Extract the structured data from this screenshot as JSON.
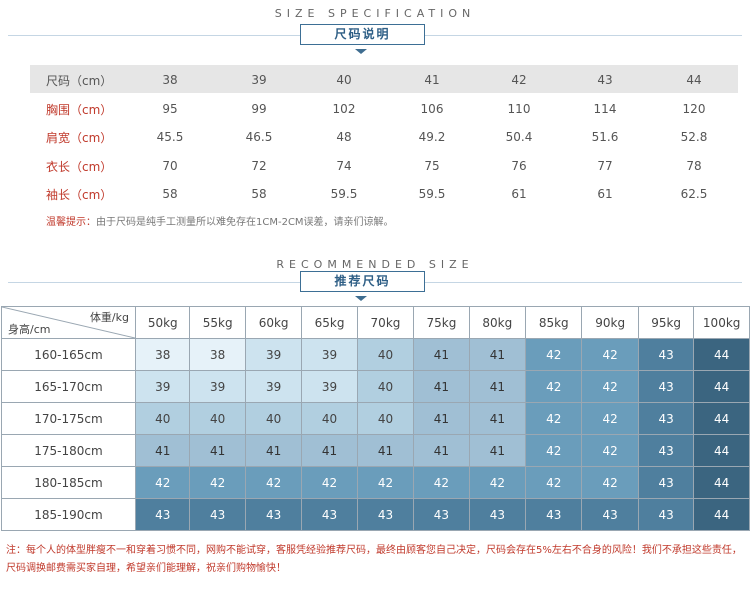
{
  "size_spec": {
    "eng_title": "SIZE SPECIFICATION",
    "cn_title": "尺码说明",
    "rows": [
      {
        "label": "尺码（cm）",
        "values": [
          "38",
          "39",
          "40",
          "41",
          "42",
          "43",
          "44"
        ]
      },
      {
        "label": "胸围（cm）",
        "values": [
          "95",
          "99",
          "102",
          "106",
          "110",
          "114",
          "120"
        ]
      },
      {
        "label": "肩宽（cm）",
        "values": [
          "45.5",
          "46.5",
          "48",
          "49.2",
          "50.4",
          "51.6",
          "52.8"
        ]
      },
      {
        "label": "衣长（cm）",
        "values": [
          "70",
          "72",
          "74",
          "75",
          "76",
          "77",
          "78"
        ]
      },
      {
        "label": "袖长（cm）",
        "values": [
          "58",
          "58",
          "59.5",
          "59.5",
          "61",
          "61",
          "62.5"
        ]
      }
    ],
    "tip_label": "温馨提示：",
    "tip_text": "由于尺码是纯手工测量所以难免存在1CM-2CM误差，请亲们谅解。"
  },
  "recommend": {
    "eng_title": "RECOMMENDED SIZE",
    "cn_title": "推荐尺码",
    "corner_weight": "体重/kg",
    "corner_height": "身高/cm",
    "weights": [
      "50kg",
      "55kg",
      "60kg",
      "65kg",
      "70kg",
      "75kg",
      "80kg",
      "85kg",
      "90kg",
      "95kg",
      "100kg"
    ],
    "rows": [
      {
        "height": "160-165cm",
        "sizes": [
          "38",
          "38",
          "39",
          "39",
          "40",
          "41",
          "41",
          "42",
          "42",
          "43",
          "44"
        ]
      },
      {
        "height": "165-170cm",
        "sizes": [
          "39",
          "39",
          "39",
          "39",
          "40",
          "41",
          "41",
          "42",
          "42",
          "43",
          "44"
        ]
      },
      {
        "height": "170-175cm",
        "sizes": [
          "40",
          "40",
          "40",
          "40",
          "40",
          "41",
          "41",
          "42",
          "42",
          "43",
          "44"
        ]
      },
      {
        "height": "175-180cm",
        "sizes": [
          "41",
          "41",
          "41",
          "41",
          "41",
          "41",
          "41",
          "42",
          "42",
          "43",
          "44"
        ]
      },
      {
        "height": "180-185cm",
        "sizes": [
          "42",
          "42",
          "42",
          "42",
          "42",
          "42",
          "42",
          "42",
          "42",
          "43",
          "44"
        ]
      },
      {
        "height": "185-190cm",
        "sizes": [
          "43",
          "43",
          "43",
          "43",
          "43",
          "43",
          "43",
          "43",
          "43",
          "43",
          "44"
        ]
      }
    ],
    "size_colors": {
      "38": "#e6f2f9",
      "39": "#cde3ef",
      "40": "#b1cfe0",
      "41": "#a0bfd4",
      "42": "#6a9dbb",
      "43": "#4f7f9e",
      "44": "#3b6580"
    },
    "size_text_colors": {
      "38": "#444",
      "39": "#444",
      "40": "#444",
      "41": "#333",
      "42": "#fff",
      "43": "#fff",
      "44": "#fff"
    }
  },
  "footer_note": "注：每个人的体型胖瘦不一和穿着习惯不同，网购不能试穿，客服凭经验推荐尺码，最终由顾客您自己决定，尺码会存在5%左右不合身的风险！我们不承担这些责任，尺码调换邮费需买家自理，希望亲们能理解，祝亲们购物愉快！"
}
